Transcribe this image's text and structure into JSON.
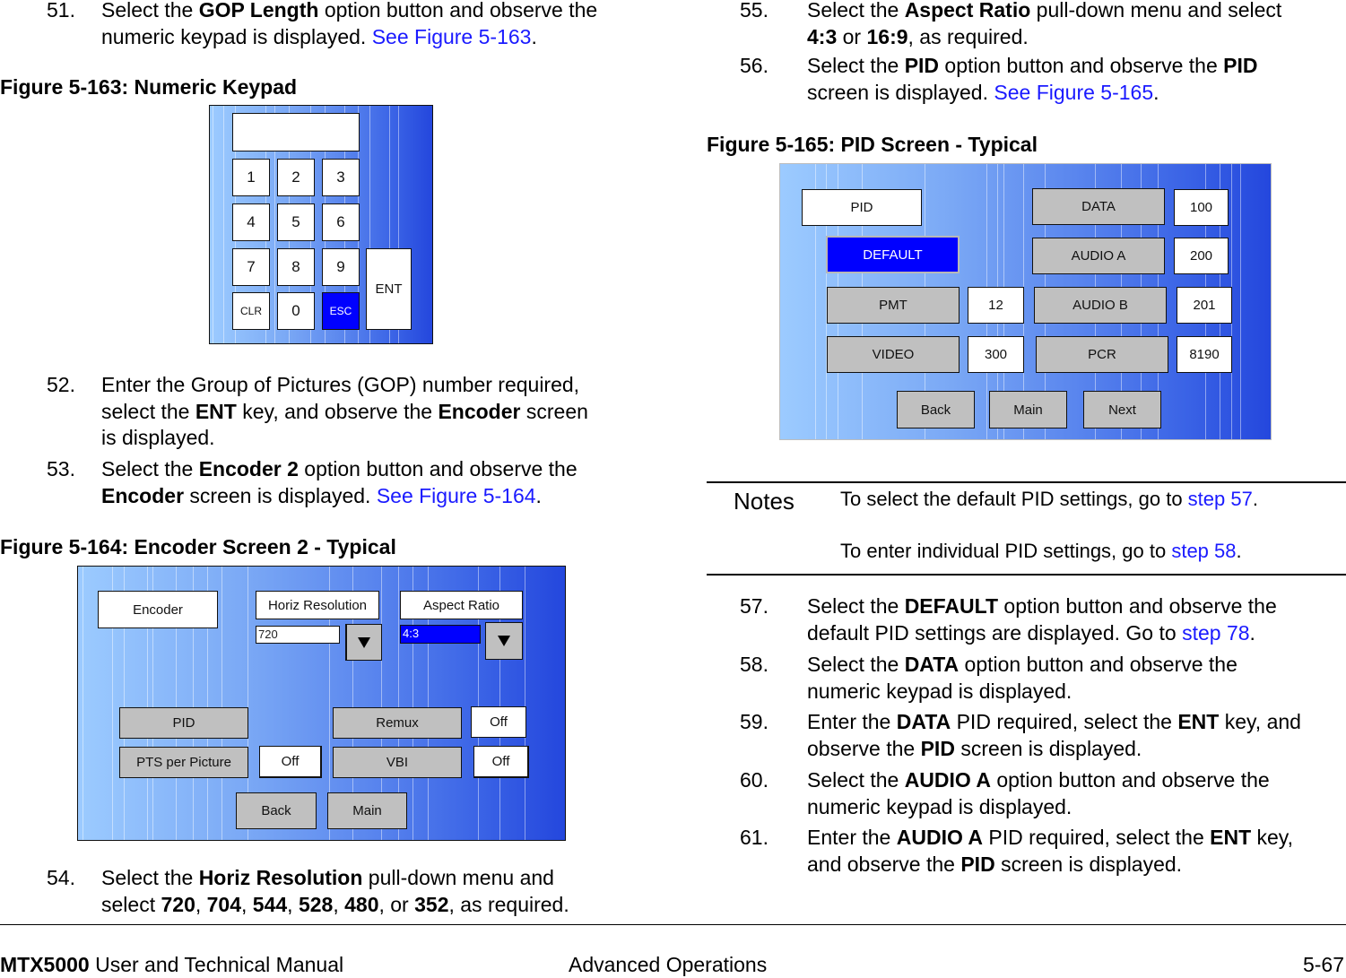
{
  "left_column": {
    "step51": {
      "num": "51.",
      "pre": "Select the ",
      "bold": "GOP Length",
      "post": " option button and observe the",
      "line2_pre": "numeric keypad is displayed.  ",
      "link": "See Figure 5-163",
      "line2_post": "."
    },
    "fig163": {
      "caption": "Figure 5-163:   Numeric Keypad",
      "display_value": "",
      "keys": [
        "1",
        "2",
        "3",
        "4",
        "5",
        "6",
        "7",
        "8",
        "9"
      ],
      "clr": "CLR",
      "zero": "0",
      "esc": "ESC",
      "ent": "ENT"
    },
    "step52": {
      "num": "52.",
      "l1": "Enter the Group of Pictures (GOP) number required,",
      "l2_a": "select the ",
      "l2_b": "ENT",
      "l2_c": " key, and observe the ",
      "l2_d": "Encoder",
      "l2_e": " screen",
      "l3": "is displayed."
    },
    "step53": {
      "num": "53.",
      "l1_a": "Select the ",
      "l1_b": "Encoder 2",
      "l1_c": " option button and observe the",
      "l2_a": "Encoder",
      "l2_b": " screen is displayed.  ",
      "l2_link": "See Figure 5-164",
      "l2_c": "."
    },
    "fig164": {
      "caption": "Figure 5-164:   Encoder Screen 2 - Typical",
      "encoder": "Encoder",
      "horiz_res_label": "Horiz Resolution",
      "horiz_res_value": "720",
      "aspect_label": "Aspect Ratio",
      "aspect_value": "4:3",
      "pid": "PID",
      "remux": "Remux",
      "remux_value": "Off",
      "pts": "PTS per Picture",
      "pts_value": "Off",
      "vbi": "VBI",
      "vbi_value": "Off",
      "back": "Back",
      "main": "Main"
    },
    "step54": {
      "num": "54.",
      "l1_a": "Select the ",
      "l1_b": "Horiz Resolution",
      "l1_c": " pull-down menu and",
      "l2": [
        "select ",
        "720",
        ", ",
        "704",
        ", ",
        "544",
        ", ",
        "528",
        ", ",
        "480",
        ", or ",
        "352",
        ", as required."
      ]
    }
  },
  "right_column": {
    "step55": {
      "num": "55.",
      "l1_a": "Select the ",
      "l1_b": "Aspect Ratio",
      "l1_c": " pull-down menu and select",
      "l2_a": "4:3",
      "l2_b": " or ",
      "l2_c": "16:9",
      "l2_d": ", as required."
    },
    "step56": {
      "num": "56.",
      "l1_a": "Select the ",
      "l1_b": "PID",
      "l1_c": " option button and observe the ",
      "l1_d": "PID",
      "l2_a": "screen is displayed.  ",
      "l2_link": "See Figure 5-165",
      "l2_b": "."
    },
    "fig165": {
      "caption": "Figure 5-165:   PID Screen - Typical",
      "pid": "PID",
      "default": "DEFAULT",
      "pmt": "PMT",
      "pmt_value": "12",
      "video": "VIDEO",
      "video_value": "300",
      "data": "DATA",
      "data_value": "100",
      "audio_a": "AUDIO A",
      "audio_a_value": "200",
      "audio_b": "AUDIO B",
      "audio_b_value": "201",
      "pcr": "PCR",
      "pcr_value": "8190",
      "back": "Back",
      "main": "Main",
      "next": "Next"
    },
    "notes": {
      "label": "Notes",
      "n1_a": "To select the default PID settings, go to ",
      "n1_link": "step 57",
      "n1_b": ".",
      "n2_a": "To enter individual PID settings, go to ",
      "n2_link": "step 58",
      "n2_b": "."
    },
    "step57": {
      "num": "57.",
      "l1_a": "Select the ",
      "l1_b": "DEFAULT",
      "l1_c": " option button and observe the",
      "l2_a": "default PID settings are displayed.  Go to ",
      "l2_link": "step 78",
      "l2_b": "."
    },
    "step58": {
      "num": "58.",
      "l1_a": "Select the ",
      "l1_b": "DATA",
      "l1_c": " option button and observe the",
      "l2": "numeric keypad is displayed."
    },
    "step59": {
      "num": "59.",
      "l1_a": "Enter the ",
      "l1_b": "DATA",
      "l1_c": " PID required, select the ",
      "l1_d": "ENT",
      "l1_e": " key, and",
      "l2_a": "observe the ",
      "l2_b": "PID",
      "l2_c": " screen is displayed."
    },
    "step60": {
      "num": "60.",
      "l1_a": "Select the ",
      "l1_b": "AUDIO A",
      "l1_c": " option button and observe the",
      "l2": "numeric keypad is displayed."
    },
    "step61": {
      "num": "61.",
      "l1_a": "Enter the ",
      "l1_b": "AUDIO A",
      "l1_c": " PID required, select the ",
      "l1_d": "ENT",
      "l1_e": " key,",
      "l2_a": "and observe the ",
      "l2_b": "PID",
      "l2_c": " screen is displayed."
    }
  },
  "footer": {
    "product": "MTX5000",
    "manual": " User and Technical Manual",
    "section": "Advanced Operations",
    "page": "5-67"
  },
  "colors": {
    "link": "#1a1aff",
    "selected_button": "#0000ff",
    "option_button": "#c0c0c0",
    "screen_gradient_start": "#9ccbff",
    "screen_gradient_end": "#2447dd"
  }
}
